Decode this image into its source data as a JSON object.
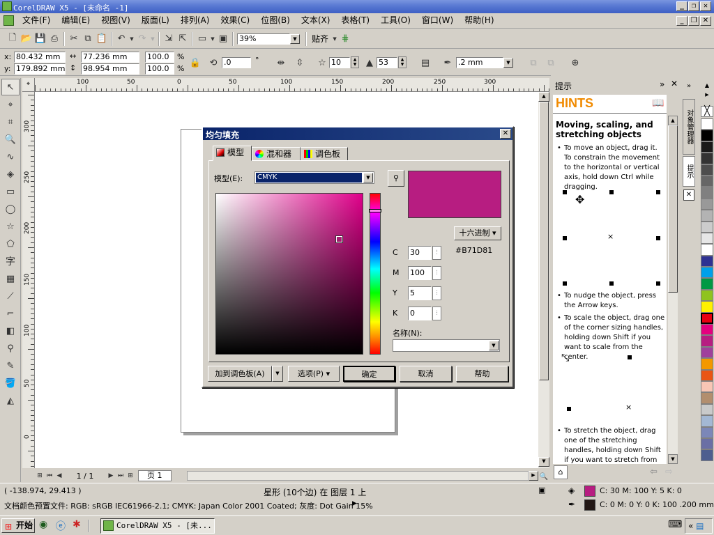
{
  "window": {
    "title": "CorelDRAW X5 - [未命名 -1]"
  },
  "menu": [
    "文件(F)",
    "编辑(E)",
    "视图(V)",
    "版面(L)",
    "排列(A)",
    "效果(C)",
    "位图(B)",
    "文本(X)",
    "表格(T)",
    "工具(O)",
    "窗口(W)",
    "帮助(H)"
  ],
  "toolbar": {
    "zoom": "39%",
    "snap_label": "贴齐"
  },
  "propbar": {
    "x": "80.432 mm",
    "y": "179.892 mm",
    "w": "77.236 mm",
    "h": "98.954 mm",
    "scale_x": "100.0",
    "scale_y": "100.0",
    "pct": "%",
    "angle": ".0",
    "deg": "°",
    "points": "10",
    "sharpness": "53",
    "outline": ".2 mm"
  },
  "ruler": {
    "h_labels": [
      "100",
      "50",
      "0",
      "50",
      "100",
      "150",
      "200",
      "250",
      "300"
    ],
    "v_labels": [
      "300",
      "250",
      "200",
      "150",
      "100",
      "50",
      "0"
    ]
  },
  "dialog": {
    "title": "均匀填充",
    "tabs": [
      "模型",
      "混和器",
      "调色板"
    ],
    "model_label": "模型(E):",
    "model_value": "CMYK",
    "hex_dropdown": "十六进制",
    "hex_value": "#B71D81",
    "fields": [
      {
        "label": "C",
        "value": "30"
      },
      {
        "label": "M",
        "value": "100"
      },
      {
        "label": "Y",
        "value": "5"
      },
      {
        "label": "K",
        "value": "0"
      }
    ],
    "name_label": "名称(N):",
    "buttons": {
      "add_palette": "加到调色板(A)",
      "options": "选项(P)",
      "ok": "确定",
      "cancel": "取消",
      "help": "帮助"
    },
    "swatch_color": "#B71D81"
  },
  "hints": {
    "panel_title": "提示",
    "header": "HINTS",
    "heading": "Moving, scaling, and stretching objects",
    "items": [
      "To move an object, drag it. To constrain the movement to the horizontal or vertical axis, hold down Ctrl while dragging.",
      "To nudge the object, press the Arrow keys.",
      "To scale the object, drag one of the corner sizing handles, holding down Shift if you want to scale from the center.",
      "To stretch the object, drag one of the stretching handles, holding down Shift if you want to stretch from the"
    ]
  },
  "docker_tabs": [
    "对象管理器",
    "提示"
  ],
  "palette": [
    "#ffffff",
    "#000000",
    "#1a1a1a",
    "#333333",
    "#4d4d4d",
    "#666666",
    "#808080",
    "#999999",
    "#b3b3b3",
    "#cccccc",
    "#e6e6e6",
    "#ffffff",
    "#2e3192",
    "#00a0e9",
    "#009944",
    "#8fc31f",
    "#fff100",
    "#e60012",
    "#e4007f",
    "#b71d81",
    "#a0409c",
    "#f39800",
    "#ea5514",
    "#f8c6b5",
    "#b28e6e",
    "#c9caca",
    "#a3b8d4",
    "#7b87b8",
    "#6a6fa5",
    "#4d5e8f"
  ],
  "pagenav": {
    "current": "1 / 1",
    "page_tab": "页 1"
  },
  "status": {
    "coords": "( -138.974, 29.413 )",
    "object": "星形 (10个边) 在 图层 1 上",
    "fill_info": "C: 30 M: 100 Y: 5 K: 0",
    "profile": "文档颜色预置文件: RGB: sRGB IEC61966-2.1; CMYK: Japan Color 2001 Coated; 灰度: Dot Gain 15%",
    "outline_info": "C: 0 M: 0 Y: 0 K: 100  .200 mm",
    "fill_color": "#B71D81",
    "outline_color": "#231815"
  },
  "taskbar": {
    "start": "开始",
    "task": "CorelDRAW X5 - [未..."
  }
}
